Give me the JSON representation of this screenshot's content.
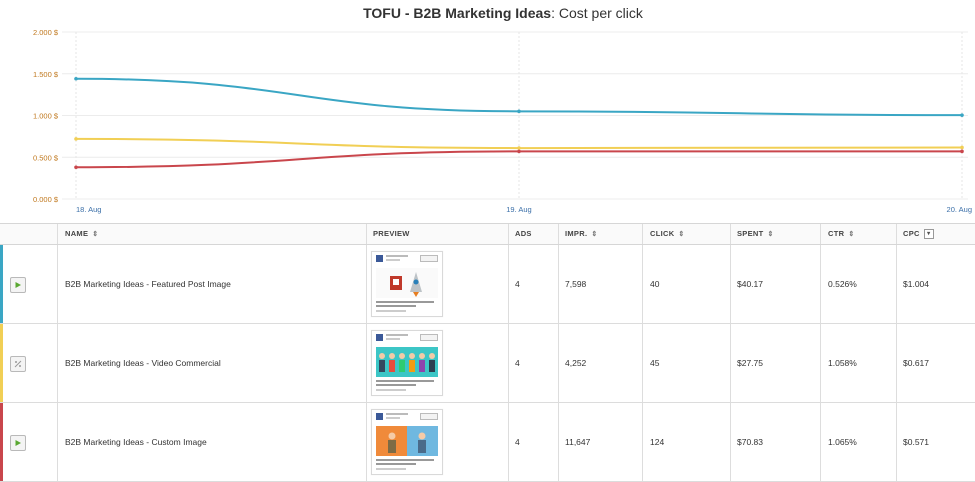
{
  "chart_data": {
    "type": "line",
    "title_bold": "TOFU - B2B Marketing Ideas",
    "title_rest": ": Cost per click",
    "x": [
      "18. Aug",
      "19. Aug",
      "20. Aug"
    ],
    "y_ticks": [
      "0.000 $",
      "0.500 $",
      "1.000 $",
      "1.500 $",
      "2.000 $"
    ],
    "ylim": [
      0,
      2
    ],
    "grid": true,
    "series": [
      {
        "color": "#3aa6c4",
        "values": [
          1.44,
          1.05,
          1.004
        ]
      },
      {
        "color": "#f1cf55",
        "values": [
          0.72,
          0.61,
          0.617
        ]
      },
      {
        "color": "#c9464c",
        "values": [
          0.38,
          0.57,
          0.571
        ]
      }
    ]
  },
  "table": {
    "headers": {
      "name": "NAME",
      "preview": "PREVIEW",
      "ads": "ADS",
      "impr": "IMPR.",
      "click": "CLICK",
      "spent": "SPENT",
      "ctr": "CTR",
      "cpc": "CPC"
    },
    "sort_icon": "⇕",
    "sort_box_icon": "▾",
    "rows": [
      {
        "color": "#3aa6c4",
        "icon": "play-icon",
        "name": "B2B Marketing Ideas - Featured Post Image",
        "ads": "4",
        "impr": "7,598",
        "click": "40",
        "spent": "$40.17",
        "ctr": "0.526%",
        "cpc": "$1.004",
        "preview_kind": "rocket"
      },
      {
        "color": "#f1cf55",
        "icon": "paused-icon",
        "name": "B2B Marketing Ideas - Video Commercial",
        "ads": "4",
        "impr": "4,252",
        "click": "45",
        "spent": "$27.75",
        "ctr": "1.058%",
        "cpc": "$0.617",
        "preview_kind": "people"
      },
      {
        "color": "#c9464c",
        "icon": "play-icon",
        "name": "B2B Marketing Ideas - Custom Image",
        "ads": "4",
        "impr": "11,647",
        "click": "124",
        "spent": "$70.83",
        "ctr": "1.065%",
        "cpc": "$0.571",
        "preview_kind": "split"
      }
    ]
  }
}
